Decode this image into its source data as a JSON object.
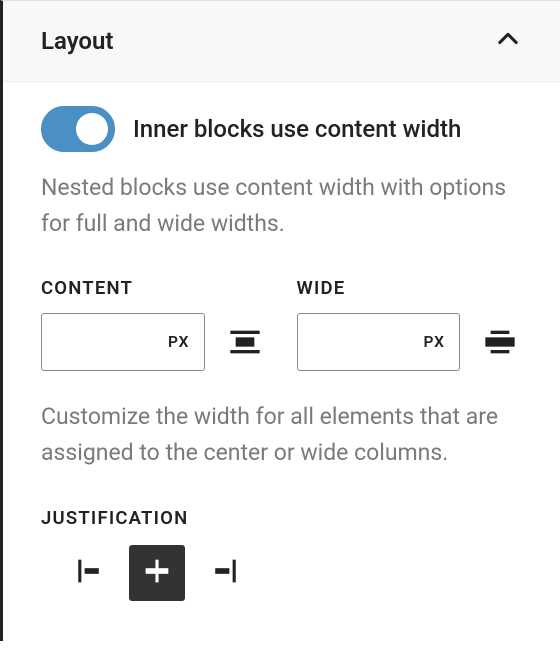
{
  "panel": {
    "title": "Layout"
  },
  "toggle": {
    "label": "Inner blocks use content width",
    "enabled": true,
    "help": "Nested blocks use content width with options for full and wide widths."
  },
  "content": {
    "label": "CONTENT",
    "unit": "PX",
    "value": ""
  },
  "wide": {
    "label": "WIDE",
    "unit": "PX",
    "value": ""
  },
  "width_help": "Customize the width for all elements that are assigned to the center or wide columns.",
  "justification": {
    "label": "JUSTIFICATION",
    "selected": "center"
  }
}
